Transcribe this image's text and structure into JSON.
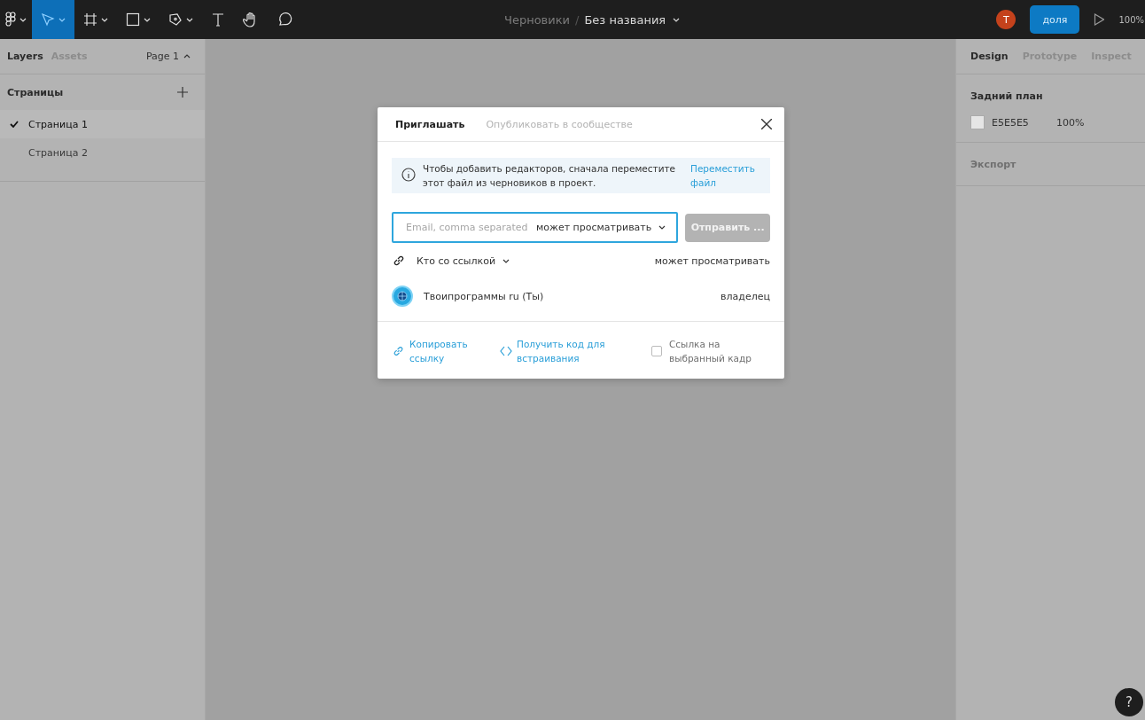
{
  "toolbar": {
    "tools": [
      {
        "kind": "logo",
        "selected": false
      },
      {
        "kind": "move",
        "selected": true
      },
      {
        "kind": "frame",
        "selected": false
      },
      {
        "kind": "shape",
        "selected": false
      },
      {
        "kind": "pen",
        "selected": false
      },
      {
        "kind": "text",
        "selected": false
      },
      {
        "kind": "hand",
        "selected": false
      },
      {
        "kind": "comment",
        "selected": false
      }
    ],
    "breadcrumb": {
      "folder": "Черновики",
      "separator": "/",
      "file": "Без названия"
    },
    "avatar": "T",
    "share_button": "доля",
    "zoom": "100%"
  },
  "left_panel": {
    "tabs": [
      {
        "label": "Layers",
        "selected": true
      },
      {
        "label": "Assets",
        "selected": false
      }
    ],
    "page_selector": "Page 1",
    "pages_title": "Страницы",
    "pages": [
      {
        "label": "Страница 1",
        "selected": true
      },
      {
        "label": "Страница 2",
        "selected": false
      }
    ]
  },
  "right_panel": {
    "tabs": [
      {
        "label": "Design",
        "selected": true
      },
      {
        "label": "Prototype",
        "selected": false
      },
      {
        "label": "Inspect",
        "selected": false
      }
    ],
    "background": {
      "title": "Задний план",
      "color": "#e5e5e5",
      "hex": "E5E5E5",
      "opacity": "100%"
    },
    "export": {
      "title": "Экспорт"
    }
  },
  "dialog": {
    "tabs": [
      {
        "label": "Приглашать",
        "selected": true
      },
      {
        "label": "Опубликовать в сообществе",
        "selected": false
      }
    ],
    "notice": {
      "text": "Чтобы добавить редакторов, сначала переместите этот файл из черновиков в проект.",
      "link": "Переместить файл"
    },
    "invite": {
      "placeholder": "Email, comma separated",
      "permission": "может просматривать",
      "send_button": "Отправить ...",
      "send_disabled": true
    },
    "link_access": {
      "label": "Кто со ссылкой",
      "permission": "может просматривать"
    },
    "members": [
      {
        "name": "Твоипрограммы ru (Ты)",
        "role": "владелец"
      }
    ],
    "footer": {
      "copy_link": "Копировать ссылку",
      "embed": "Получить код для встраивания",
      "frame_link": {
        "label": "Ссылка на выбранный кадр",
        "checked": false
      }
    }
  },
  "help_button": "?"
}
